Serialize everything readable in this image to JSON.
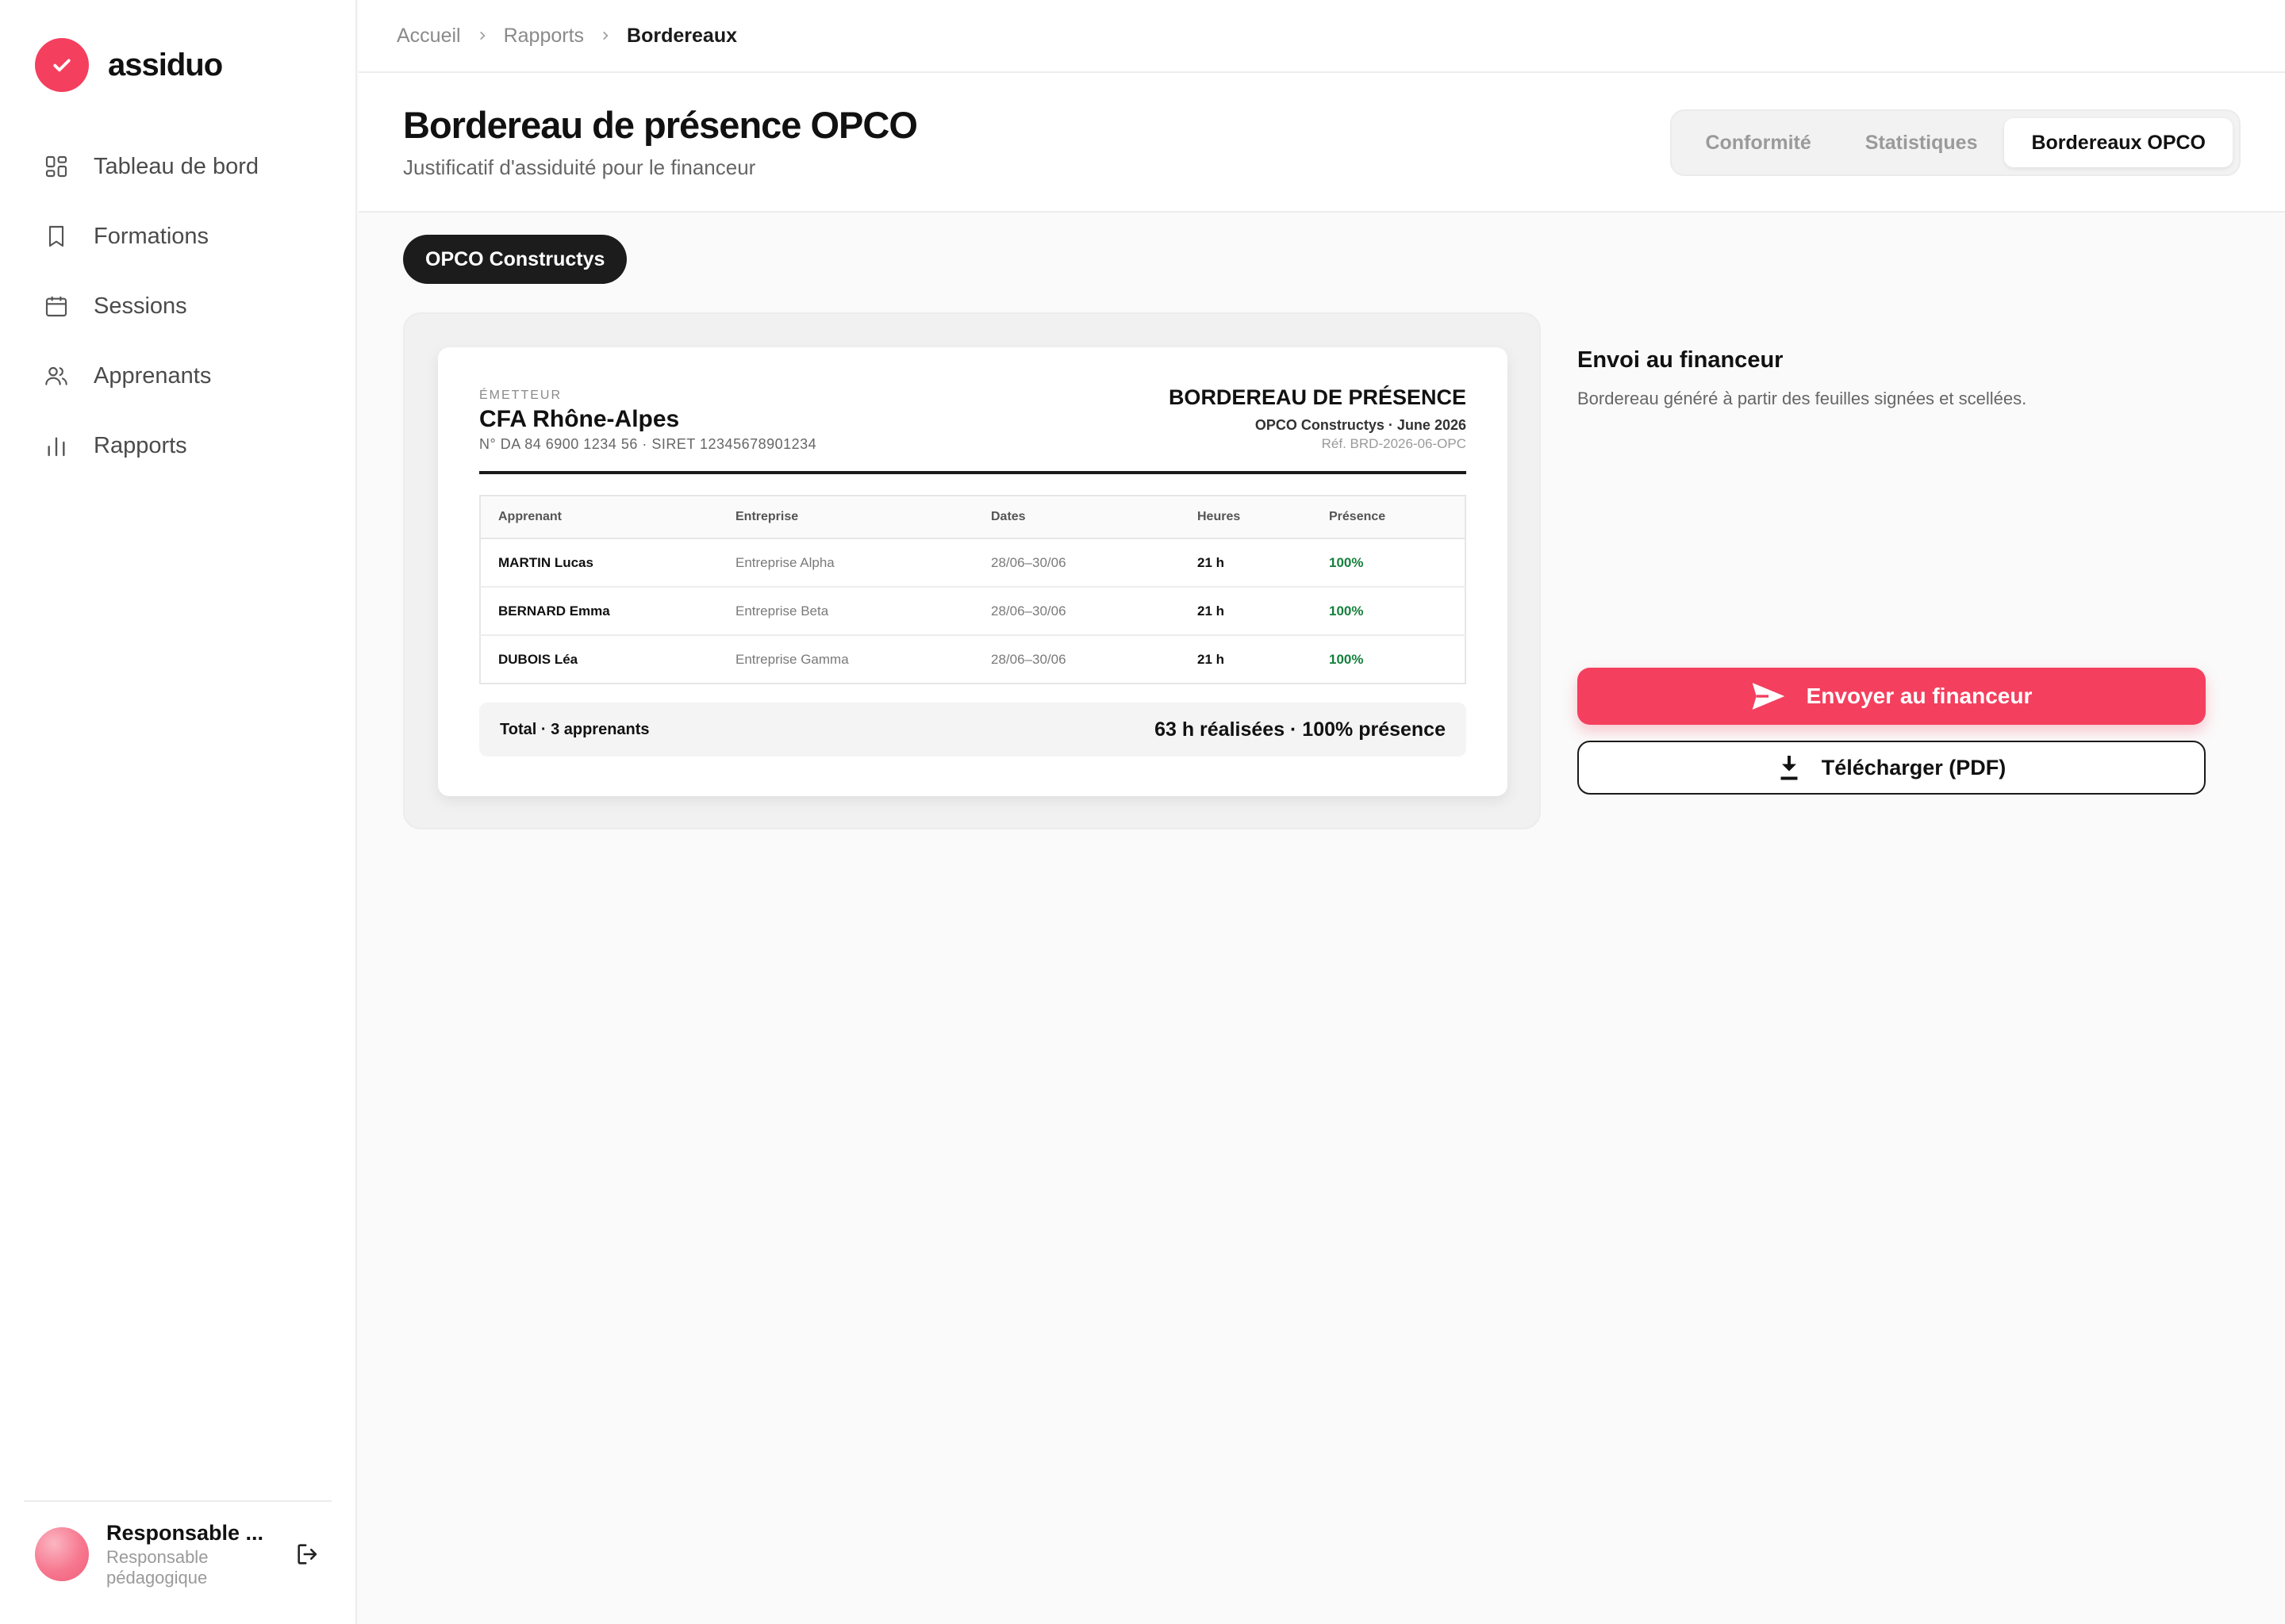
{
  "app": {
    "name": "assiduo",
    "accent": "#f43f5e"
  },
  "sidebar": {
    "items": [
      {
        "label": "Tableau de bord",
        "icon": "dashboard-icon"
      },
      {
        "label": "Formations",
        "icon": "bookmark-icon"
      },
      {
        "label": "Sessions",
        "icon": "calendar-icon"
      },
      {
        "label": "Apprenants",
        "icon": "users-icon"
      },
      {
        "label": "Rapports",
        "icon": "bar-chart-icon"
      }
    ],
    "user": {
      "name": "Responsable ...",
      "role": "Responsable pédagogique"
    }
  },
  "breadcrumb": [
    "Accueil",
    "Rapports",
    "Bordereaux"
  ],
  "page": {
    "title": "Bordereau de présence OPCO",
    "subtitle": "Justificatif d'assiduité pour le financeur",
    "tabs": [
      "Conformité",
      "Statistiques",
      "Bordereaux OPCO"
    ],
    "active_tab": "Bordereaux OPCO"
  },
  "filter": {
    "selected": "OPCO Constructys"
  },
  "document": {
    "issuer_label": "ÉMETTEUR",
    "issuer_name": "CFA Rhône-Alpes",
    "issuer_ids": "N° DA 84 6900 1234 56 · SIRET 12345678901234",
    "title": "BORDEREAU DE PRÉSENCE",
    "meta": "OPCO Constructys · June 2026",
    "ref": "Réf. BRD-2026-06-OPC",
    "columns": [
      "Apprenant",
      "Entreprise",
      "Dates",
      "Heures",
      "Présence"
    ],
    "rows": [
      {
        "name": "MARTIN Lucas",
        "company": "Entreprise Alpha",
        "dates": "28/06–30/06",
        "hours": "21 h",
        "presence": "100%"
      },
      {
        "name": "BERNARD Emma",
        "company": "Entreprise Beta",
        "dates": "28/06–30/06",
        "hours": "21 h",
        "presence": "100%"
      },
      {
        "name": "DUBOIS Léa",
        "company": "Entreprise Gamma",
        "dates": "28/06–30/06",
        "hours": "21 h",
        "presence": "100%"
      }
    ],
    "total_left": "Total · 3 apprenants",
    "total_right": "63 h réalisées · 100% présence"
  },
  "send": {
    "title": "Envoi au financeur",
    "description": "Bordereau généré à partir des feuilles signées et scellées.",
    "send_label": "Envoyer au financeur",
    "download_label": "Télécharger (PDF)"
  }
}
